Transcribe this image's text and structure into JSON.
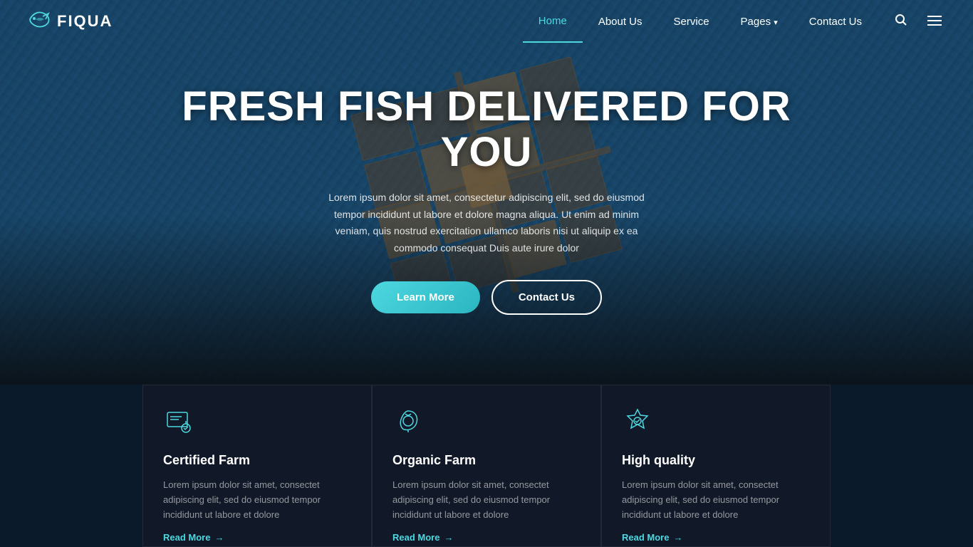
{
  "brand": {
    "name": "FIQUA",
    "logo_symbol": "🐟"
  },
  "nav": {
    "links": [
      {
        "label": "Home",
        "active": true
      },
      {
        "label": "About Us",
        "active": false
      },
      {
        "label": "Service",
        "active": false
      },
      {
        "label": "Pages",
        "active": false,
        "has_dropdown": true
      },
      {
        "label": "Contact Us",
        "active": false
      }
    ],
    "search_label": "search",
    "menu_label": "menu"
  },
  "hero": {
    "title": "FRESH FISH DELIVERED FOR YOU",
    "description": "Lorem ipsum dolor sit amet, consectetur adipiscing elit, sed do eiusmod tempor incididunt ut labore et dolore magna aliqua. Ut enim ad minim veniam, quis nostrud exercitation ullamco laboris nisi ut aliquip ex ea commodo consequat Duis aute irure dolor",
    "btn_learn": "Learn More",
    "btn_contact": "Contact Us"
  },
  "cards": [
    {
      "id": "certified-farm",
      "title": "Certified Farm",
      "description": "Lorem ipsum dolor sit amet, consectet adipiscing elit, sed do eiusmod tempor incididunt ut labore et dolore",
      "link_text": "Read More",
      "icon": "certificate"
    },
    {
      "id": "organic-farm",
      "title": "Organic Farm",
      "description": "Lorem ipsum dolor sit amet, consectet adipiscing elit, sed do eiusmod tempor incididunt ut labore et dolore",
      "link_text": "Read More",
      "icon": "leaf"
    },
    {
      "id": "high-quality",
      "title": "High quality",
      "description": "Lorem ipsum dolor sit amet, consectet adipiscing elit, sed do eiusmod tempor incididunt ut labore et dolore",
      "link_text": "Read More",
      "icon": "badge"
    }
  ]
}
